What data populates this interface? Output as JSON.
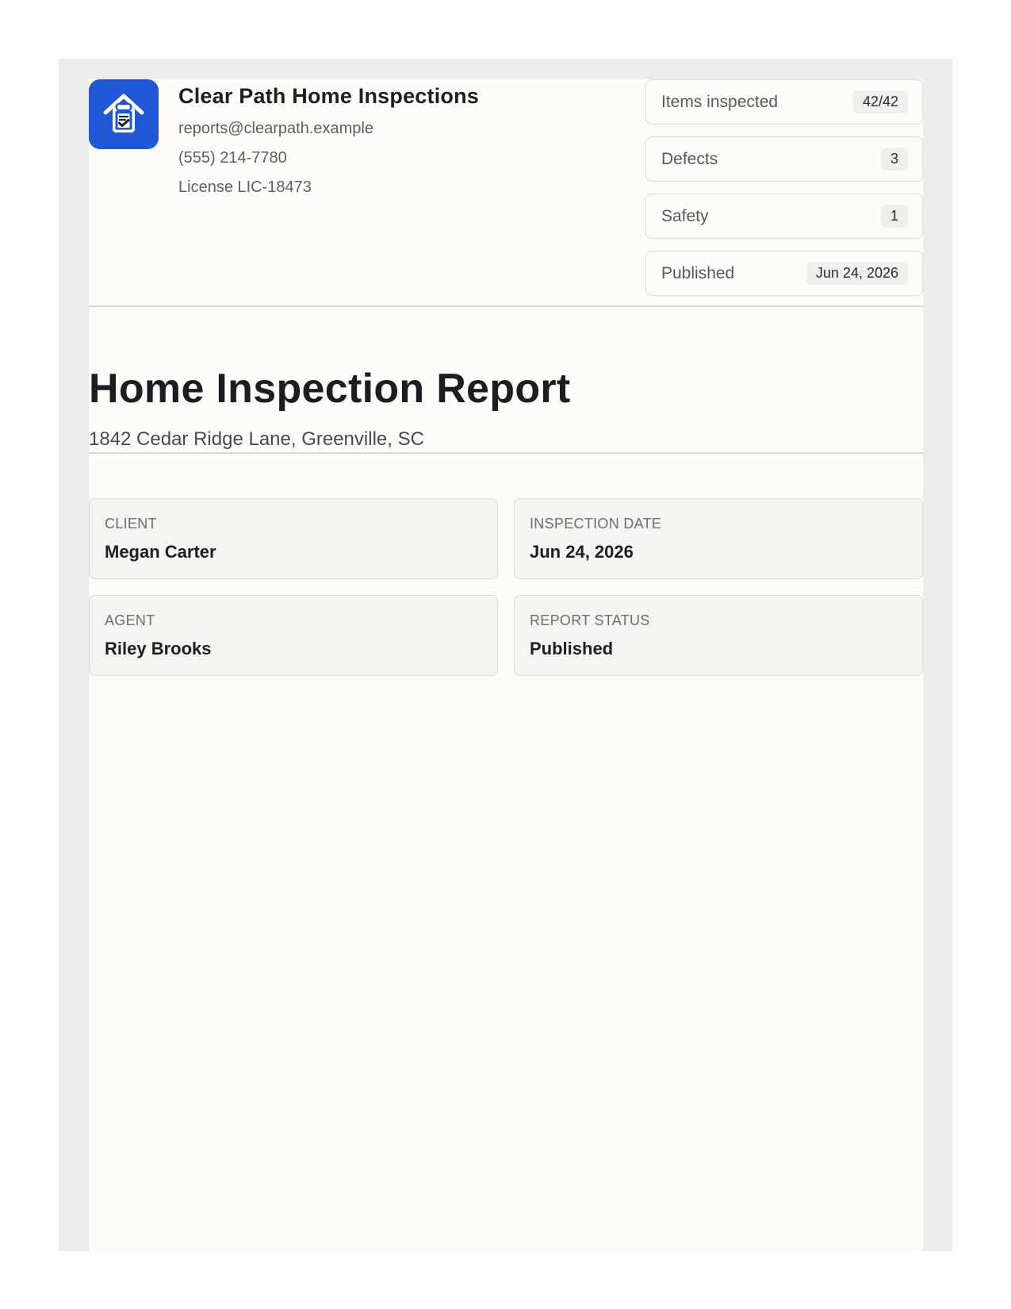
{
  "company": {
    "name": "Clear Path Home Inspections",
    "email": "reports@clearpath.example",
    "phone": "(555) 214-7780",
    "license": "License LIC-18473",
    "logo_icon": "house-clipboard-icon",
    "brand_color": "#1f57d6"
  },
  "stats": [
    {
      "label": "Items inspected",
      "value": "42/42"
    },
    {
      "label": "Defects",
      "value": "3"
    },
    {
      "label": "Safety",
      "value": "1"
    },
    {
      "label": "Published",
      "value": "Jun 24, 2026"
    }
  ],
  "report": {
    "title": "Home Inspection Report",
    "address": "1842 Cedar Ridge Lane, Greenville, SC"
  },
  "details": [
    {
      "label": "CLIENT",
      "value": "Megan Carter"
    },
    {
      "label": "INSPECTION DATE",
      "value": "Jun 24, 2026"
    },
    {
      "label": "AGENT",
      "value": "Riley Brooks"
    },
    {
      "label": "REPORT STATUS",
      "value": "Published"
    }
  ]
}
